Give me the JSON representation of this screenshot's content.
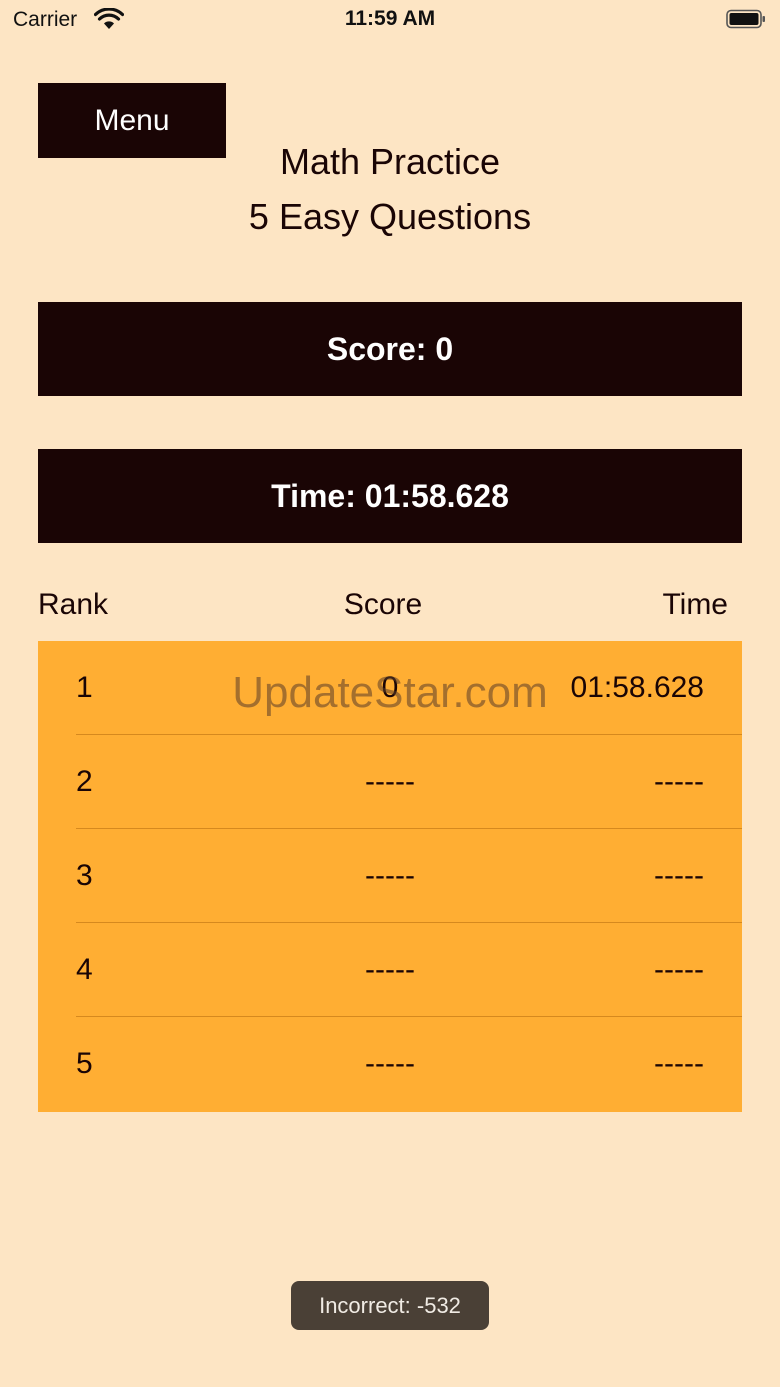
{
  "status_bar": {
    "carrier": "Carrier",
    "time": "11:59 AM"
  },
  "menu": {
    "label": "Menu"
  },
  "title": "Math Practice",
  "subtitle": "5 Easy Questions",
  "score_label": "Score: 0",
  "time_label": "Time: 01:58.628",
  "leaderboard": {
    "headers": {
      "rank": "Rank",
      "score": "Score",
      "time": "Time"
    },
    "rows": [
      {
        "rank": "1",
        "score": "0",
        "time": "01:58.628"
      },
      {
        "rank": "2",
        "score": "-----",
        "time": "-----"
      },
      {
        "rank": "3",
        "score": "-----",
        "time": "-----"
      },
      {
        "rank": "4",
        "score": "-----",
        "time": "-----"
      },
      {
        "rank": "5",
        "score": "-----",
        "time": "-----"
      }
    ]
  },
  "watermark": "UpdateStar.com",
  "toast": "Incorrect: -532",
  "colors": {
    "background": "#fde5c4",
    "bar": "#1a0505",
    "table": "#ffae33",
    "toast": "#4a4036"
  }
}
